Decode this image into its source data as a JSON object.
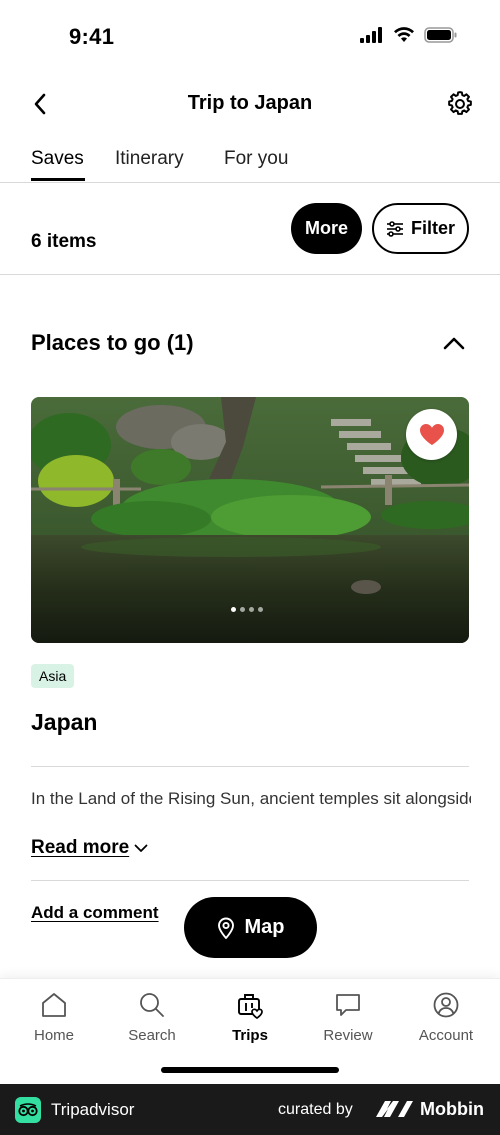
{
  "status": {
    "time": "9:41"
  },
  "header": {
    "title": "Trip to Japan"
  },
  "tabs": [
    {
      "label": "Saves"
    },
    {
      "label": "Itinerary"
    },
    {
      "label": "For you"
    }
  ],
  "toolbar": {
    "count": "6 items",
    "more_label": "More",
    "filter_label": "Filter"
  },
  "section": {
    "title": "Places to go (1)"
  },
  "place": {
    "badge": "Asia",
    "name": "Japan",
    "description": "In the Land of the Rising Sun, ancient temples sit alongside neon wonderlands and shinto shrines offe…",
    "read_more": "Read more",
    "add_comment": "Add a comment",
    "map_label": "Map",
    "carousel": {
      "current": 1,
      "total": 4
    }
  },
  "nav": [
    {
      "label": "Home",
      "icon": "home-icon"
    },
    {
      "label": "Search",
      "icon": "search-icon"
    },
    {
      "label": "Trips",
      "icon": "trips-icon"
    },
    {
      "label": "Review",
      "icon": "review-icon"
    },
    {
      "label": "Account",
      "icon": "account-icon"
    }
  ],
  "footer": {
    "brand": "Tripadvisor",
    "curated": "curated by",
    "mobbin": "Mobbin"
  },
  "colors": {
    "accent": "#000000",
    "heart": "#e8524a",
    "badge_bg": "#d9f2e6",
    "brand_green": "#34e0a1"
  }
}
